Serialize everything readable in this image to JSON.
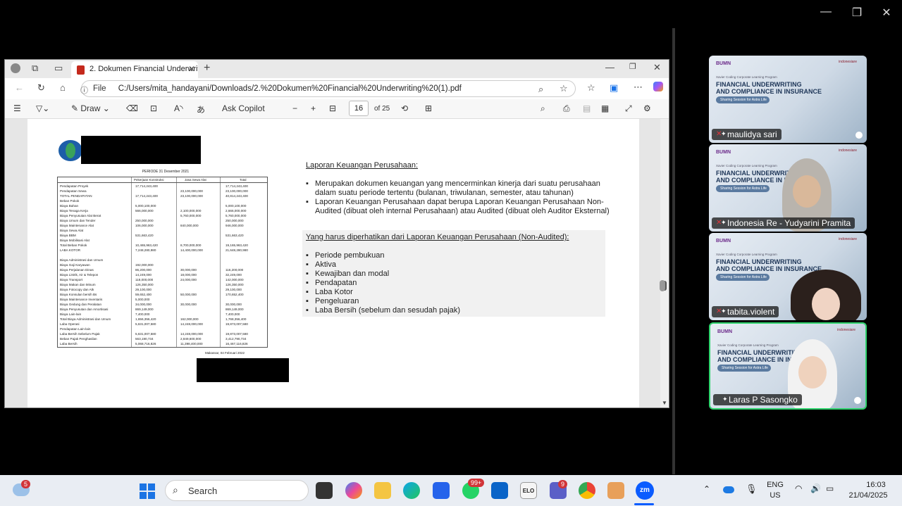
{
  "browser": {
    "tab_title": "2. Dokumen Financial Underwriting",
    "file_label": "File",
    "url": "C:/Users/mita_handayani/Downloads/2.%20Dokumen%20Financial%20Underwriting%20(1).pdf",
    "toolbar": {
      "draw_label": "Draw",
      "ask_copilot": "Ask Copilot",
      "page_current": "16",
      "page_total": "of 25"
    }
  },
  "pdf": {
    "fin_period": "PERIODE 31 Desember 2021",
    "fin_date": "Makassar, 04 Februari 2022",
    "col_headers": [
      "Pekerjaan Konstruksi",
      "Jasa Sewa Alat",
      "Total"
    ],
    "rows": [
      {
        "label": "Pendapatan Proyek",
        "a": "17,714,243,400",
        "b": "",
        "t": "17,714,243,400"
      },
      {
        "label": "Pendapatan Sewa",
        "a": "",
        "b": "23,100,000,000",
        "t": "23,100,000,000"
      },
      {
        "label": "TOTAL PENDAPATAN",
        "a": "17,714,243,400",
        "b": "23,100,000,000",
        "t": "40,814,243,400"
      },
      {
        "label": "Beban Pokok",
        "a": "",
        "b": "",
        "t": ""
      },
      {
        "label": "Biaya Bahan",
        "a": "5,000,100,000",
        "b": "",
        "t": "5,000,100,000"
      },
      {
        "label": "Biaya Tenaga Kerja",
        "a": "566,000,000",
        "b": "2,100,000,000",
        "t": "2,666,000,000"
      },
      {
        "label": "Biaya Penyusutan Alat Berat",
        "a": "",
        "b": "5,760,000,000",
        "t": "5,760,000,000"
      },
      {
        "label": "Biaya Umum dan Tender",
        "a": "250,000,000",
        "b": "",
        "t": "250,000,000"
      },
      {
        "label": "Biaya Maintenance Alat",
        "a": "106,000,000",
        "b": "840,000,000",
        "t": "946,000,000"
      },
      {
        "label": "Biaya Sewa Alat",
        "a": "",
        "b": "",
        "t": ""
      },
      {
        "label": "Biaya BBM",
        "a": "531,663,420",
        "b": "",
        "t": "531,663,420"
      },
      {
        "label": "Biaya Mobilisasi Alat",
        "a": "",
        "b": "",
        "t": ""
      },
      {
        "label": "Total Beban Pokok",
        "a": "10,465,963,420",
        "b": "8,700,000,000",
        "t": "19,165,963,420"
      },
      {
        "label": "LABA KOTOR",
        "a": "7,248,280,980",
        "b": "14,400,000,000",
        "t": "21,648,280,980"
      },
      {
        "label": "",
        "a": "",
        "b": "",
        "t": ""
      },
      {
        "label": "Biaya Administrasi dan Umum",
        "a": "",
        "b": "",
        "t": ""
      },
      {
        "label": "Biaya Gaji Karyawan",
        "a": "192,000,000",
        "b": "",
        "t": ""
      },
      {
        "label": "Biaya Perjalanan Dinas",
        "a": "86,200,000",
        "b": "30,000,000",
        "t": "116,200,000"
      },
      {
        "label": "Biaya Listrik, Air & Telepon",
        "a": "14,249,000",
        "b": "18,000,000",
        "t": "32,249,000"
      },
      {
        "label": "Biaya Transport",
        "a": "118,000,000",
        "b": "24,000,000",
        "t": "142,000,000"
      },
      {
        "label": "Biaya Makan dan Minum",
        "a": "126,350,000",
        "b": "",
        "t": "126,350,000"
      },
      {
        "label": "Biaya Fotocopy dan Atk",
        "a": "29,100,000",
        "b": "",
        "t": "29,100,000"
      },
      {
        "label": "Biaya Konsulan bersih Bs",
        "a": "59,652,400",
        "b": "50,000,000",
        "t": "170,652,400"
      },
      {
        "label": "Biaya Maintenance Inventaris",
        "a": "5,000,000",
        "b": "",
        "t": ""
      },
      {
        "label": "Biaya Gedung dan Peralatan",
        "a": "34,000,000",
        "b": "30,000,000",
        "t": "30,000,000"
      },
      {
        "label": "Biaya Penyusutan dan Amortisasi",
        "a": "869,149,000",
        "b": "",
        "t": "869,149,000"
      },
      {
        "label": "Biaya Lain-lain",
        "a": "7,400,000",
        "b": "",
        "t": "7,400,000"
      },
      {
        "label": "Total Biaya Administrasi dan Umum",
        "a": "1,656,356,420",
        "b": "162,000,000",
        "t": "1,768,356,400"
      },
      {
        "label": "Laba Operasi",
        "a": "5,631,007,580",
        "b": "14,248,000,000",
        "t": "19,873,007,580"
      },
      {
        "label": "Pendapatan Lain-lain",
        "a": "",
        "b": "",
        "t": ""
      },
      {
        "label": "Laba Bersih Sebelum Pajak",
        "a": "5,631,007,580",
        "b": "14,248,000,000",
        "t": "19,873,007,580"
      },
      {
        "label": "Beban Pajak Penghasilan",
        "a": "563,190,734",
        "b": "2,849,600,000",
        "t": "3,412,790,734"
      },
      {
        "label": "Laba Bersih",
        "a": "5,068,716,826",
        "b": "11,398,400,000",
        "t": "16,467,116,826"
      }
    ],
    "heading": "Laporan Keuangan Perusahaan:",
    "bullets": [
      "Merupakan dokumen keuangan yang mencerminkan kinerja dari suatu perusahaan",
      "dalam suatu periode tertentu (bulanan, triwulanan, semester, atau tahunan)",
      "Laporan Keuangan Perusahaan dapat berupa Laporan Keuangan Perusahaan Non-",
      "Audited (dibuat oleh internal Perusahaan) atau Audited (dibuat oleh Auditor Eksternal)"
    ],
    "heading2": "Yang harus diperhatikan dari Laporan Keuangan Perusahaan (Non-Audited):",
    "items": [
      "Periode pembukuan",
      "Aktiva",
      "Kewajiban dan modal",
      "Pendapatan",
      "Laba Kotor",
      "Pengeluaran",
      "Laba Bersih (sebelum dan sesudah pajak)"
    ]
  },
  "tiles": {
    "slide_brand": "BUMN",
    "slide_partner": "indonesiare",
    "slide_kicker": "Xavier Coding Corporate Learning Program",
    "slide_title_1": "FINANCIAL UNDERWRITING",
    "slide_title_2": "AND COMPLIANCE IN INSURANCE",
    "slide_pill": "Sharing Session for Astra Life",
    "participants": [
      {
        "name": "maulidya sari"
      },
      {
        "name": "Indonesia Re - Yudyarini Pramita"
      },
      {
        "name": "tabita.violent"
      },
      {
        "name": "Laras P Sasongko"
      }
    ]
  },
  "taskbar": {
    "search_label": "Search",
    "weather_badge": "5",
    "whatsapp_badge": "99+",
    "teams_badge": "9",
    "lang": "ENG",
    "region": "US",
    "time": "16:03",
    "date": "21/04/2025"
  },
  "colors": {
    "accent": "#2fd36d",
    "pdf_red": "#c4291c",
    "badge_red": "#d13438"
  }
}
